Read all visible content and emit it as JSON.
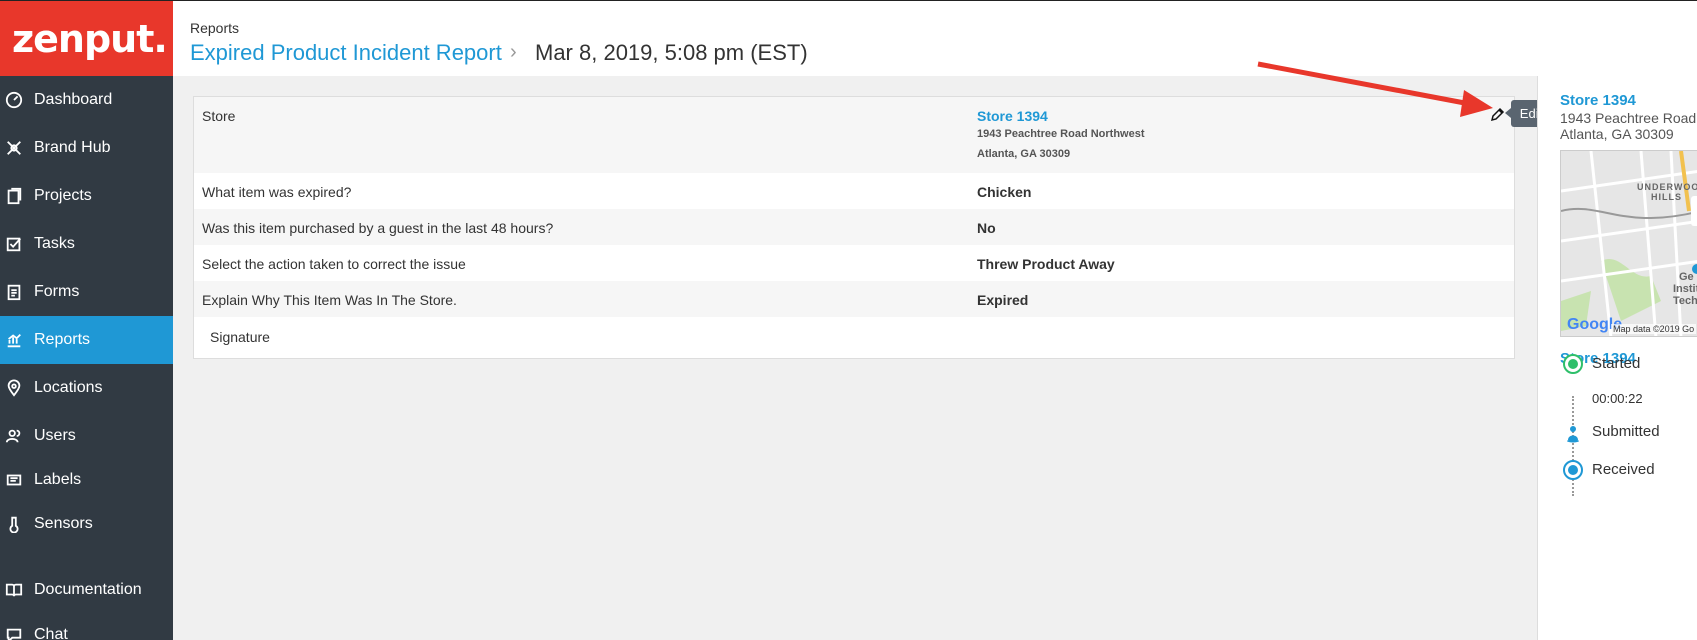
{
  "app": {
    "logo": "zenput."
  },
  "sidebar": {
    "items": [
      {
        "label": "Dashboard",
        "icon": "dashboard-icon"
      },
      {
        "label": "Brand Hub",
        "icon": "brand-hub-icon"
      },
      {
        "label": "Projects",
        "icon": "projects-icon"
      },
      {
        "label": "Tasks",
        "icon": "tasks-icon"
      },
      {
        "label": "Forms",
        "icon": "forms-icon"
      },
      {
        "label": "Reports",
        "icon": "reports-icon",
        "active": true
      },
      {
        "label": "Locations",
        "icon": "location-pin-icon"
      },
      {
        "label": "Users",
        "icon": "users-icon"
      },
      {
        "label": "Labels",
        "icon": "labels-icon"
      },
      {
        "label": "Sensors",
        "icon": "thermometer-icon"
      },
      {
        "label": "Documentation",
        "icon": "book-icon"
      },
      {
        "label": "Chat",
        "icon": "chat-icon"
      }
    ]
  },
  "header": {
    "breadcrumb": "Reports",
    "title": "Expired Product Incident Report",
    "separator": "›",
    "date": "Mar 8, 2019, 5:08 pm (EST)"
  },
  "report": {
    "store": {
      "question": "Store",
      "name": "Store 1394",
      "address_line1": "1943 Peachtree Road Northwest",
      "address_line2": "Atlanta, GA  30309"
    },
    "rows": [
      {
        "question": "What item was expired?",
        "answer": "Chicken"
      },
      {
        "question": "Was this item purchased by a guest in the last 48 hours?",
        "answer": "No"
      },
      {
        "question": "Select the action taken to correct the issue",
        "answer": "Threw Product Away"
      },
      {
        "question": "Explain Why This Item Was In The Store.",
        "answer": "Expired"
      }
    ],
    "signature_label": "Signature",
    "edit_tooltip": "Edit"
  },
  "right_panel": {
    "store_name": "Store 1394",
    "address_line1": "1943 Peachtree Road",
    "address_line2": "Atlanta, GA 30309",
    "map": {
      "label_top": "UNDERWOOD",
      "label_top2": "HILLS",
      "label_mid1": "Ge",
      "label_mid2": "Instit",
      "label_mid3": "Tech",
      "google": "Google",
      "map_data": "Map data ©2019 Go"
    },
    "store_name_2": "Store 1394",
    "timeline": {
      "started": "Started",
      "duration": "00:00:22",
      "submitted": "Submitted",
      "received": "Received"
    }
  },
  "colors": {
    "accent": "#1f98d5",
    "brand": "#e8372b",
    "sidebar": "#313a43",
    "arrow": "#e8372b"
  }
}
